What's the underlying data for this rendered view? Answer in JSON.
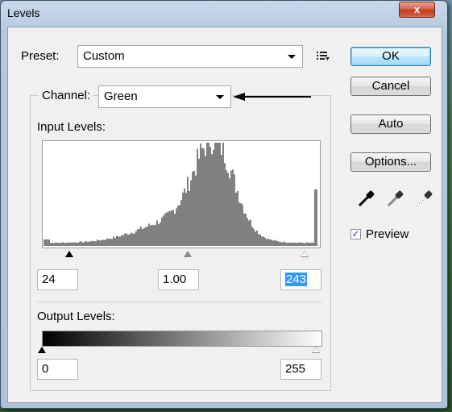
{
  "window": {
    "title": "Levels",
    "close_glyph": "x"
  },
  "preset": {
    "label": "Preset:",
    "value": "Custom"
  },
  "channel": {
    "label": "Channel:",
    "value": "Green"
  },
  "input_levels": {
    "label": "Input Levels:",
    "black": "24",
    "gamma": "1.00",
    "white": "243"
  },
  "output_levels": {
    "label": "Output Levels:",
    "black": "0",
    "white": "255"
  },
  "buttons": {
    "ok": "OK",
    "cancel": "Cancel",
    "auto": "Auto",
    "options": "Options..."
  },
  "preview": {
    "label": "Preview",
    "checked": true
  },
  "icons": [
    "preset-menu-icon",
    "black-eyedropper-icon",
    "gray-eyedropper-icon",
    "white-eyedropper-icon",
    "pointer-arrow-icon"
  ]
}
